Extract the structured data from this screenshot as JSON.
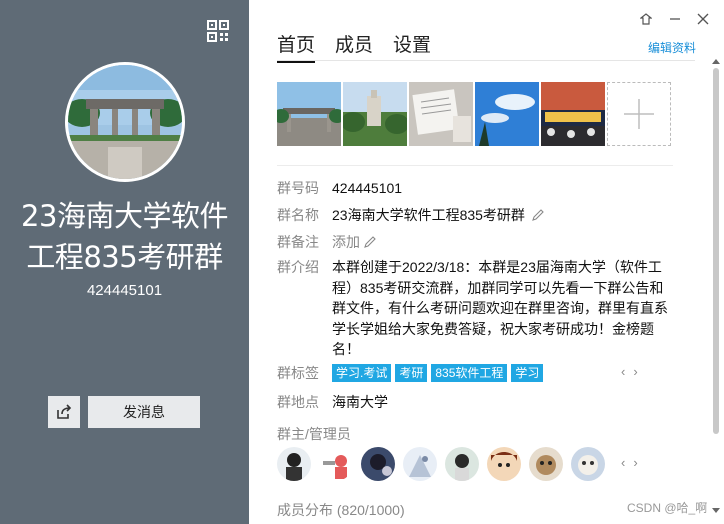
{
  "left": {
    "title_line1": "23海南大学软件",
    "title_line2": "工程835考研群",
    "group_id": "424445101",
    "send_message": "发消息",
    "icons": {
      "qr": "qr-code-icon",
      "share": "share-icon"
    }
  },
  "tabs": [
    {
      "label": "首页",
      "active": true
    },
    {
      "label": "成员",
      "active": false
    },
    {
      "label": "设置",
      "active": false
    }
  ],
  "edit_profile": "编辑资料",
  "info": {
    "group_number_label": "群号码",
    "group_number": "424445101",
    "group_name_label": "群名称",
    "group_name": "23海南大学软件工程835考研群",
    "remark_label": "群备注",
    "remark_value": "添加",
    "intro_label": "群介绍",
    "intro": "本群创建于2022/3/18：本群是23届海南大学（软件工程）835考研交流群，加群同学可以先看一下群公告和群文件，有什么考研问题欢迎在群里咨询，群里有直系学长学姐给大家免费答疑，祝大家考研成功！金榜题名！",
    "tags_label": "群标签",
    "tags": [
      "学习.考试",
      "考研",
      "835软件工程",
      "学习"
    ],
    "location_label": "群地点",
    "location": "海南大学",
    "admins_label": "群主/管理员",
    "distribution": "成员分布 (820/1000)"
  },
  "watermark": "CSDN @哈_啊",
  "colors": {
    "left_panel": "#5f6b76",
    "accent": "#1a8fd8",
    "tag": "#20a7e3"
  }
}
